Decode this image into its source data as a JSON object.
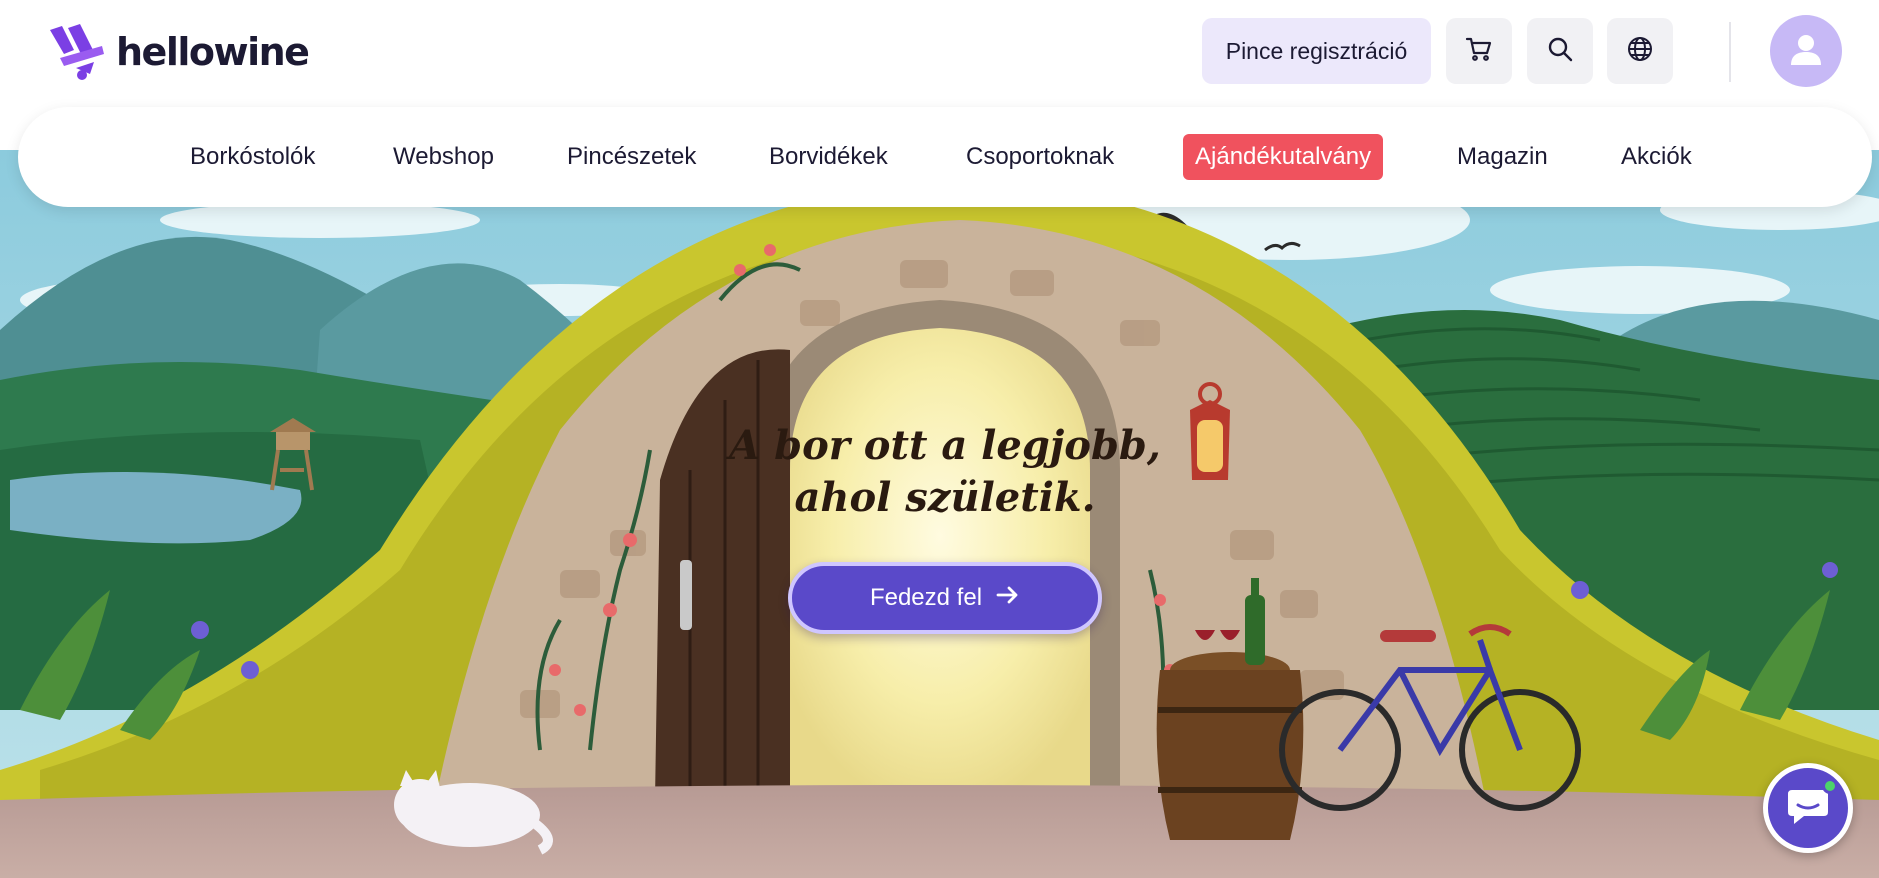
{
  "header": {
    "logo_text": "hellowine",
    "logo_icon": "hellowine-logo-icon",
    "register_label": "Pince regisztráció",
    "cart_icon": "cart-icon",
    "search_icon": "search-icon",
    "language_icon": "globe-icon",
    "account_icon": "user-icon"
  },
  "nav": {
    "items": [
      {
        "label": "Borkóstolók"
      },
      {
        "label": "Webshop"
      },
      {
        "label": "Pincészetek"
      },
      {
        "label": "Borvidékek"
      },
      {
        "label": "Csoportoknak"
      },
      {
        "label": "Ajándékutalvány",
        "highlight": true
      },
      {
        "label": "Magazin"
      },
      {
        "label": "Akciók"
      }
    ]
  },
  "hero": {
    "title_line1": "A bor ott a legjobb,",
    "title_line2": "ahol születik.",
    "cta_label": "Fedezd fel",
    "cta_icon": "arrow-right-icon"
  },
  "chat": {
    "icon": "chat-bubble-icon"
  },
  "colors": {
    "brand_purple": "#5a49c9",
    "gift_red": "#f0525e",
    "light_purple": "#ece8fb",
    "avatar_purple": "#c7b9f6"
  }
}
